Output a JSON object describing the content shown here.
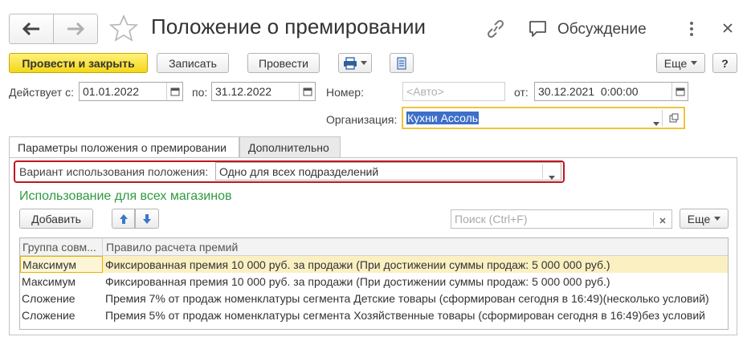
{
  "window": {
    "title": "Положение о премировании",
    "discussion_label": "Обсуждение"
  },
  "toolbar": {
    "post_close_label": "Провести и закрыть",
    "save_label": "Записать",
    "post_label": "Провести",
    "more_label": "Еще",
    "help_label": "?"
  },
  "header": {
    "valid_from_label": "Действует с:",
    "valid_from_value": "01.01.2022",
    "valid_to_label": "по:",
    "valid_to_value": "31.12.2022",
    "number_label": "Номер:",
    "number_placeholder": "<Авто>",
    "date_label": "от:",
    "date_value": "30.12.2021  0:00:00",
    "org_label": "Организация:",
    "org_value": "Кухни Ассоль"
  },
  "tabs": [
    {
      "label": "Параметры положения о премировании",
      "active": true
    },
    {
      "label": "Дополнительно",
      "active": false
    }
  ],
  "params": {
    "variant_label": "Вариант использования положения:",
    "variant_value": "Одно для всех подразделений",
    "section_title": "Использование для всех магазинов",
    "add_label": "Добавить",
    "search_placeholder": "Поиск (Ctrl+F)",
    "more_label": "Еще"
  },
  "table": {
    "columns": [
      "Группа совм...",
      "Правило расчета премий"
    ],
    "rows": [
      {
        "group": "Максимум",
        "rule": "Фиксированная премия 10 000 руб. за продажи (При достижении суммы продаж: 5 000 000 руб.)",
        "selected": true
      },
      {
        "group": "Максимум",
        "rule": "Фиксированная премия 10 000 руб. за продажи (При достижении суммы продаж: 5 000 000 руб.)",
        "selected": false
      },
      {
        "group": "Сложение",
        "rule": "Премия 7% от продаж номенклатуры сегмента Детские товары (сформирован сегодня в 16:49)(несколько условий)",
        "selected": false
      },
      {
        "group": "Сложение",
        "rule": "Премия 5% от продаж номенклатуры сегмента Хозяйственные товары (сформирован сегодня в 16:49)без условий",
        "selected": false
      }
    ]
  },
  "colors": {
    "accent_yellow": "#f4d718",
    "section_green": "#2e9a3f",
    "highlight_red": "#c0161c",
    "selection_row": "#fbf0c2",
    "org_border": "#f0c43a",
    "org_selection": "#3d6fc9"
  }
}
